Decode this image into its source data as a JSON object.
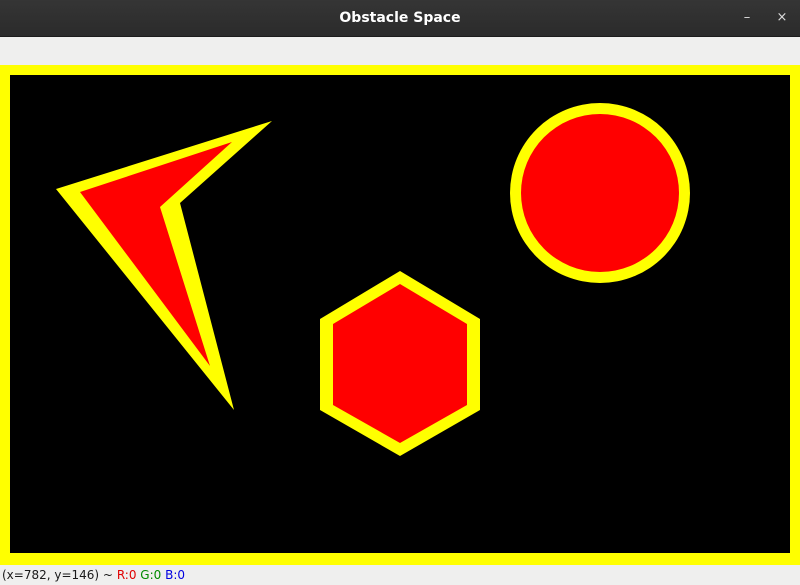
{
  "window": {
    "title": "Obstacle Space",
    "minimize_glyph": "–",
    "close_glyph": "×"
  },
  "canvas": {
    "background_color": "#000000",
    "border_color": "#ffff00",
    "obstacle_fill_color": "#ff0000",
    "obstacle_outline_color": "#ffff00",
    "obstacles": [
      "arrow-polygon",
      "hexagon",
      "circle"
    ]
  },
  "status": {
    "coords": "(x=782, y=146) ~",
    "r": "R:0",
    "g": "G:0",
    "b": "B:0"
  }
}
